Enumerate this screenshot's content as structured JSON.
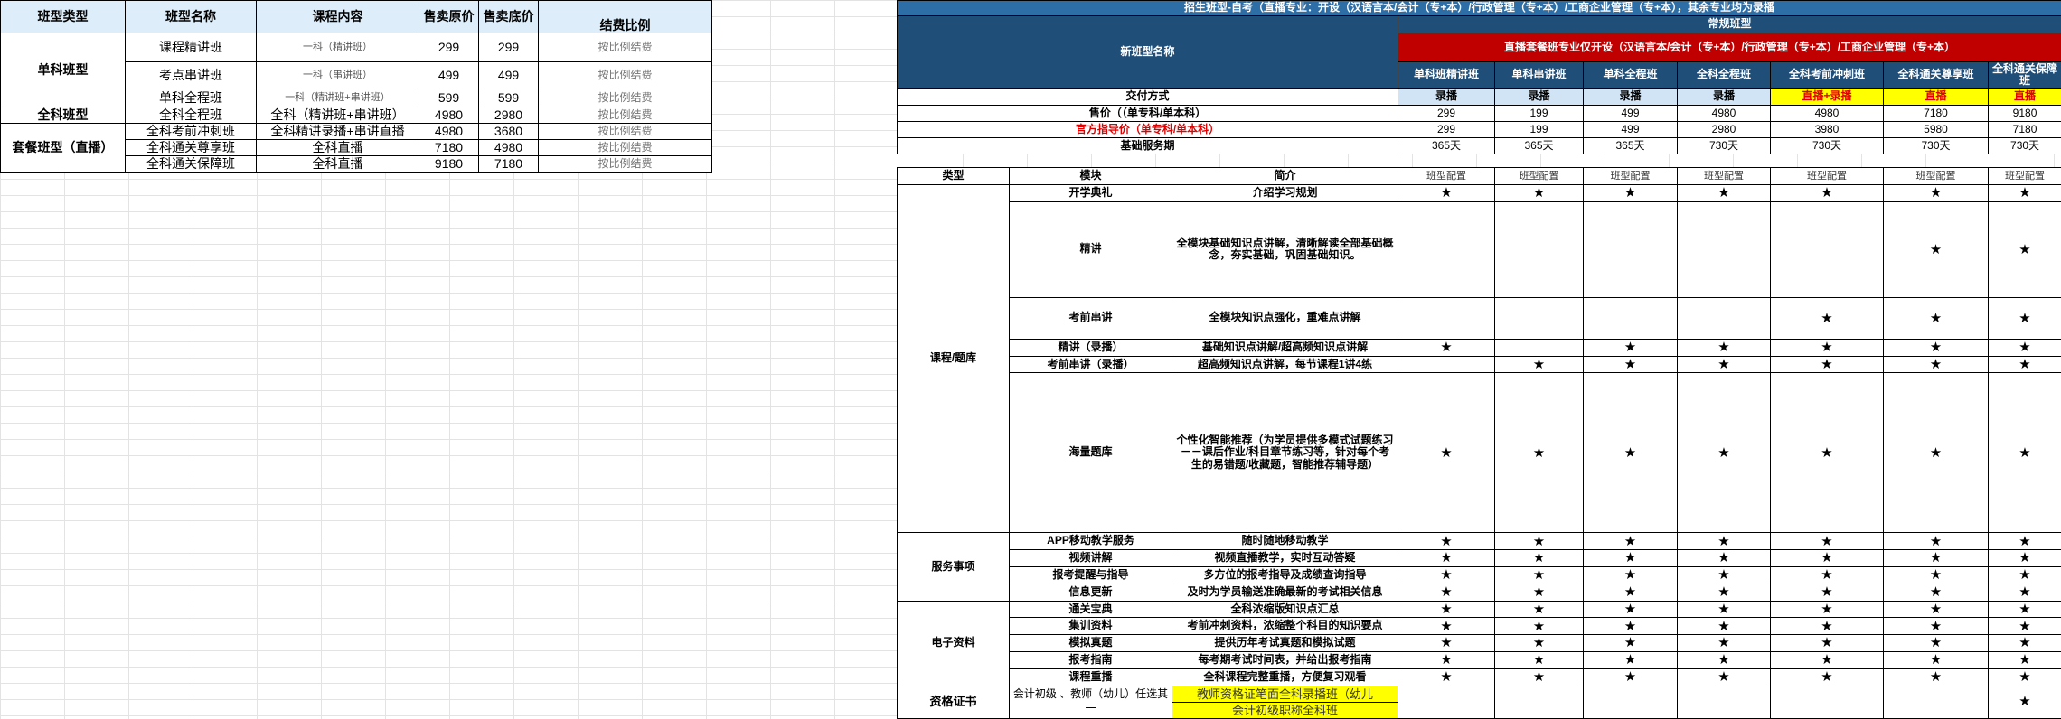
{
  "left": {
    "headers": [
      "班型类型",
      "班型名称",
      "课程内容",
      "售卖原价",
      "售卖底价",
      "结费比例"
    ],
    "groups": {
      "single": "单科班型",
      "full": "全科班型",
      "package": "套餐班型（直播）"
    },
    "rows": [
      {
        "name": "课程精讲班",
        "content": "一科（精讲班）",
        "orig": "299",
        "floor": "299",
        "ratio": "按比例结费"
      },
      {
        "name": "考点串讲班",
        "content": "一科（串讲班）",
        "orig": "499",
        "floor": "499",
        "ratio": "按比例结费"
      },
      {
        "name": "单科全程班",
        "content": "一科（精讲班+串讲班）",
        "orig": "599",
        "floor": "599",
        "ratio": "按比例结费"
      },
      {
        "name": "全科全程班",
        "content": "全科（精讲班+串讲班）",
        "orig": "4980",
        "floor": "2980",
        "ratio": "按比例结费"
      },
      {
        "name": "全科考前冲刺班",
        "content": "全科精讲录播+串讲直播",
        "orig": "4980",
        "floor": "3680",
        "ratio": "按比例结费"
      },
      {
        "name": "全科通关尊享班",
        "content": "全科直播",
        "orig": "7180",
        "floor": "4980",
        "ratio": "按比例结费"
      },
      {
        "name": "全科通关保障班",
        "content": "全科直播",
        "orig": "9180",
        "floor": "7180",
        "ratio": "按比例结费"
      }
    ]
  },
  "right": {
    "title": "招生班型-自考（直播专业：开设（汉语言本/会计（专+本）/行政管理（专+本）/工商企业管理（专+本），其余专业均为录播",
    "new_type_label": "新班型名称",
    "regular_label": "常规班型",
    "direct_note": "直播套餐班专业仅开设（汉语言本/会计（专+本）/行政管理（专+本）/工商企业管理（专+本）",
    "classes": [
      "单科班精讲班",
      "单科串讲班",
      "单科全程班",
      "全科全程班",
      "全科考前冲刺班",
      "全科通关尊享班",
      "全科通关保障班"
    ],
    "delivery_label": "交付方式",
    "delivery": [
      "录播",
      "录播",
      "录播",
      "录播",
      "直播+录播",
      "直播",
      "直播"
    ],
    "price_label": "售价（（单专科/单本科）",
    "prices": [
      "299",
      "199",
      "499",
      "4980",
      "4980",
      "7180",
      "9180"
    ],
    "guide_label": "官方指导价（单专科/单本科）",
    "guides": [
      "299",
      "199",
      "499",
      "2980",
      "3980",
      "5980",
      "7180"
    ],
    "service_label": "基础服务期",
    "services": [
      "365天",
      "365天",
      "365天",
      "730天",
      "730天",
      "730天",
      "730天"
    ],
    "col_type": "类型",
    "col_module": "模块",
    "col_intro": "简介",
    "config_label": "班型配置",
    "star": "★",
    "sections": {
      "course": "课程/题库",
      "service": "服务事项",
      "ebook": "电子资料",
      "cert": "资格证书"
    },
    "modules": [
      {
        "name": "开学典礼",
        "intro": "介绍学习规划",
        "stars": [
          1,
          1,
          1,
          1,
          1,
          1,
          1
        ]
      },
      {
        "name": "精讲",
        "intro": "全模块基础知识点讲解，清晰解读全部基础概念，夯实基础，巩固基础知识。",
        "stars": [
          0,
          0,
          0,
          0,
          0,
          1,
          1
        ]
      },
      {
        "name": "考前串讲",
        "intro": "全模块知识点强化，重难点讲解",
        "stars": [
          0,
          0,
          0,
          0,
          1,
          1,
          1
        ]
      },
      {
        "name": "精讲（录播）",
        "intro": "基础知识点讲解/超高频知识点讲解",
        "stars": [
          1,
          0,
          1,
          1,
          1,
          1,
          1
        ]
      },
      {
        "name": "考前串讲（录播）",
        "intro": "超高频知识点讲解，每节课程1讲4练",
        "stars": [
          0,
          1,
          1,
          1,
          1,
          1,
          1
        ]
      },
      {
        "name": "海量题库",
        "intro": "个性化智能推荐（为学员提供多模式试题练习－－课后作业/科目章节练习等，针对每个考生的易错题/收藏题，智能推荐辅导题）",
        "stars": [
          1,
          1,
          1,
          1,
          1,
          1,
          1
        ]
      },
      {
        "name": "APP移动教学服务",
        "intro": "随时随地移动教学",
        "stars": [
          1,
          1,
          1,
          1,
          1,
          1,
          1
        ]
      },
      {
        "name": "视频讲解",
        "intro": "视频直播教学，实时互动答疑",
        "stars": [
          1,
          1,
          1,
          1,
          1,
          1,
          1
        ]
      },
      {
        "name": "报考提醒与指导",
        "intro": "多方位的报考指导及成绩查询指导",
        "stars": [
          1,
          1,
          1,
          1,
          1,
          1,
          1
        ]
      },
      {
        "name": "信息更新",
        "intro": "及时为学员输送准确最新的考试相关信息",
        "stars": [
          1,
          1,
          1,
          1,
          1,
          1,
          1
        ]
      },
      {
        "name": "通关宝典",
        "intro": "全科浓缩版知识点汇总",
        "stars": [
          1,
          1,
          1,
          1,
          1,
          1,
          1
        ]
      },
      {
        "name": "集训资料",
        "intro": "考前冲刺资料，浓缩整个科目的知识要点",
        "stars": [
          1,
          1,
          1,
          1,
          1,
          1,
          1
        ]
      },
      {
        "name": "模拟真题",
        "intro": "提供历年考试真题和模拟试题",
        "stars": [
          1,
          1,
          1,
          1,
          1,
          1,
          1
        ]
      },
      {
        "name": "报考指南",
        "intro": "每考期考试时间表，并给出报考指南",
        "stars": [
          1,
          1,
          1,
          1,
          1,
          1,
          1
        ]
      },
      {
        "name": "课程重播",
        "intro": "全科课程完整重播，方便复习观看",
        "stars": [
          1,
          1,
          1,
          1,
          1,
          1,
          1
        ]
      }
    ],
    "cert_module": "会计初级 、教师（幼儿）任选其一",
    "cert_line1": "教师资格证笔面全科录播班（幼儿",
    "cert_line2": "会计初级职称全科班",
    "cert_stars": [
      0,
      0,
      0,
      0,
      0,
      0,
      1
    ]
  }
}
